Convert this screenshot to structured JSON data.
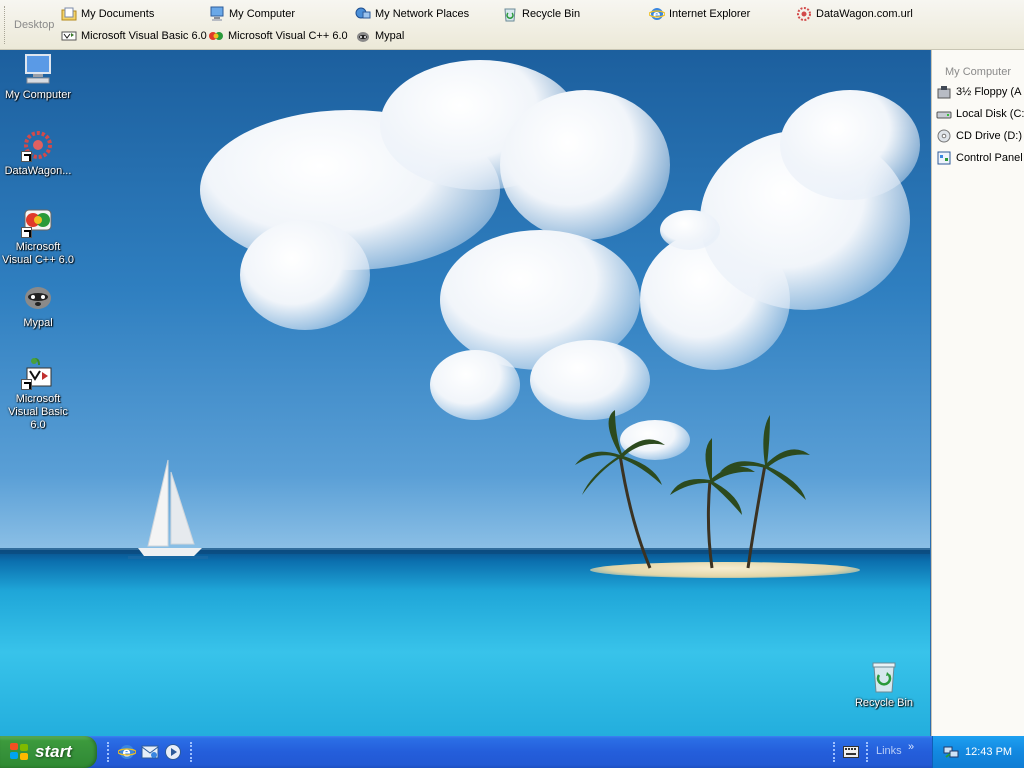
{
  "toolbar": {
    "title": "Desktop",
    "items": [
      {
        "label": "My Documents",
        "icon": "my-documents-icon"
      },
      {
        "label": "My Computer",
        "icon": "my-computer-icon"
      },
      {
        "label": "My Network Places",
        "icon": "network-places-icon"
      },
      {
        "label": "Recycle Bin",
        "icon": "recycle-bin-icon"
      },
      {
        "label": "Internet Explorer",
        "icon": "internet-explorer-icon"
      },
      {
        "label": "DataWagon.com.url",
        "icon": "url-shortcut-icon"
      },
      {
        "label": "Microsoft Visual Basic 6.0",
        "icon": "visual-basic-icon"
      },
      {
        "label": "Microsoft Visual C++ 6.0",
        "icon": "visual-cpp-icon"
      },
      {
        "label": "Mypal",
        "icon": "mypal-icon"
      }
    ]
  },
  "sidebar": {
    "title": "My Computer",
    "items": [
      {
        "label": "3½ Floppy (A",
        "icon": "floppy-drive-icon"
      },
      {
        "label": "Local Disk (C:",
        "icon": "hard-disk-icon"
      },
      {
        "label": "CD Drive (D:)",
        "icon": "cd-drive-icon"
      },
      {
        "label": "Control Panel",
        "icon": "control-panel-icon"
      }
    ]
  },
  "desktop": {
    "icons": [
      {
        "label": "My Computer",
        "icon": "my-computer-icon"
      },
      {
        "label": "DataWagon...",
        "icon": "url-shortcut-icon"
      },
      {
        "label": "Microsoft Visual C++ 6.0",
        "icon": "visual-cpp-icon"
      },
      {
        "label": "Mypal",
        "icon": "mypal-icon"
      },
      {
        "label": "Microsoft Visual Basic 6.0",
        "icon": "visual-basic-icon"
      },
      {
        "label": "Recycle Bin",
        "icon": "recycle-bin-icon"
      }
    ]
  },
  "taskbar": {
    "start_label": "start",
    "quick_launch": [
      "internet-explorer-icon",
      "outlook-express-icon",
      "media-player-icon"
    ],
    "links_label": "Links",
    "links_chevron": "»",
    "clock": "12:43 PM"
  },
  "colors": {
    "taskbar_blue": "#245edb",
    "start_green": "#36913a",
    "tray_blue": "#1288e0",
    "toolbar_beige": "#ece9d8"
  }
}
